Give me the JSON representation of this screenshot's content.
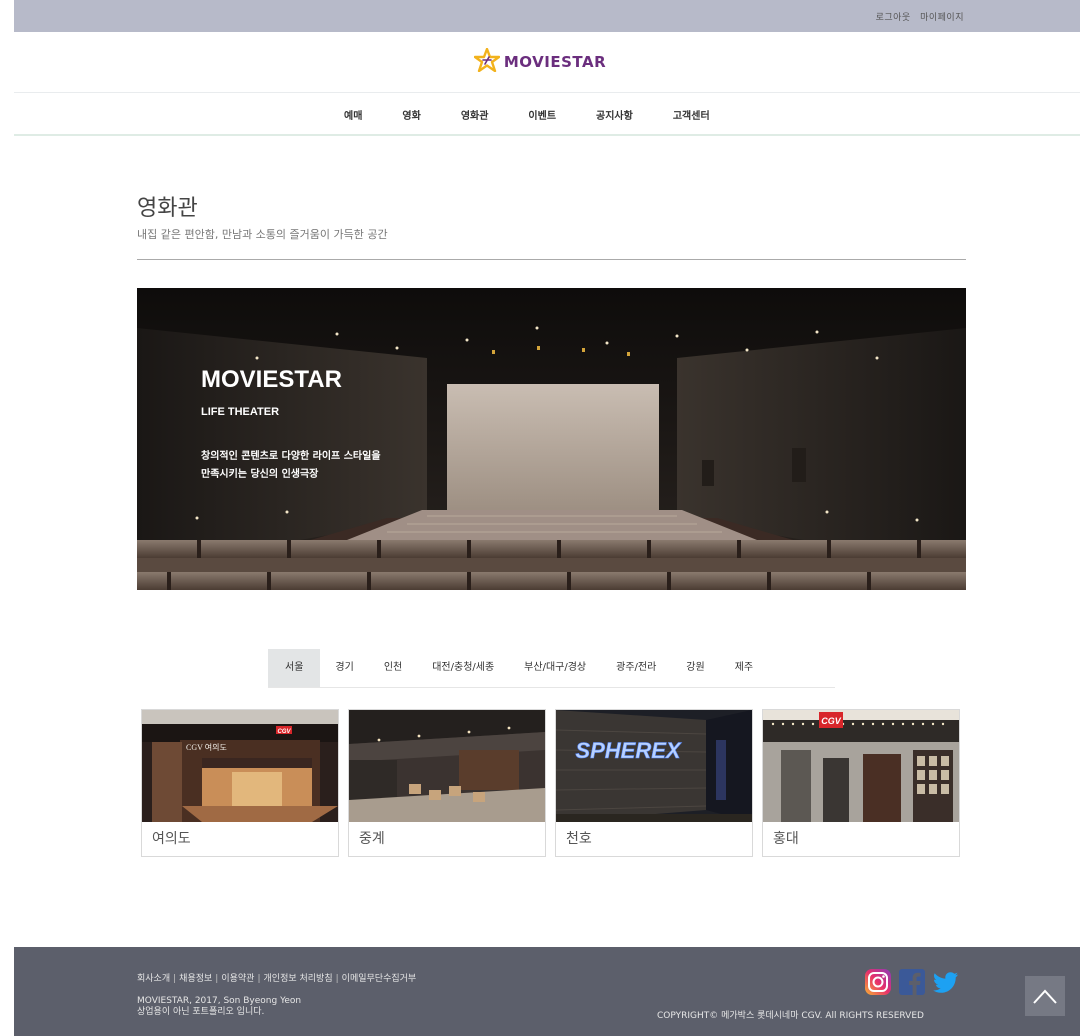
{
  "header": {
    "util_links": [
      "로그아웃",
      "마이페이지"
    ],
    "logo_text": "MOVIESTAR"
  },
  "nav": {
    "items": [
      "예매",
      "영화",
      "영화관",
      "이벤트",
      "공지사항",
      "고객센터"
    ]
  },
  "page": {
    "title": "영화관",
    "subtitle": "내집 같은 편안함, 만남과 소통의 즐거움이 가득한 공간"
  },
  "hero": {
    "title": "MOVIESTAR",
    "tagline": "LIFE THEATER",
    "copy_line1": "창의적인 콘텐츠로 다양한 라이프 스타일을",
    "copy_line2": "만족시키는 당신의 인생극장"
  },
  "regions": {
    "tabs": [
      "서울",
      "경기",
      "인천",
      "대전/충청/세종",
      "부산/대구/경상",
      "광주/전라",
      "강원",
      "제주"
    ],
    "active": "서울"
  },
  "theaters": [
    {
      "name": "여의도",
      "sign_text": "CGV 여의도",
      "brand": "CGV"
    },
    {
      "name": "중계"
    },
    {
      "name": "천호",
      "sign_text": "SPHEREX"
    },
    {
      "name": "홍대",
      "brand": "CGV"
    }
  ],
  "footer": {
    "links": [
      "회사소개",
      "채용정보",
      "이용약관",
      "개인정보 처리방침",
      "이메일무단수집거부"
    ],
    "info_line1": "MOVIESTAR, 2017, Son Byeong Yeon",
    "info_line2": "상업용이 아닌 포트폴리오 입니다.",
    "copyright": "COPYRIGHT© 메가박스 롯데시네마 CGV. All RIGHTS RESERVED",
    "social": [
      "instagram-icon",
      "facebook-icon",
      "twitter-icon"
    ]
  },
  "colors": {
    "topbar": "#b7bac9",
    "footer": "#5c5f6b",
    "logo": "#6b2e7e",
    "logo_star": "#f2b21c"
  }
}
